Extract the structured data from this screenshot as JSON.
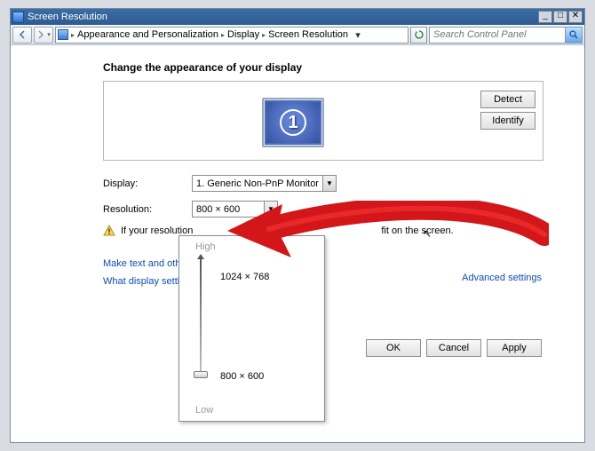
{
  "window": {
    "title": "Screen Resolution"
  },
  "winbtns": {
    "min": "_",
    "max": "□",
    "close": "✕"
  },
  "breadcrumbs": {
    "item1": "Appearance and Personalization",
    "item2": "Display",
    "item3": "Screen Resolution",
    "sep": "▸"
  },
  "search": {
    "placeholder": "Search Control Panel"
  },
  "heading": "Change the appearance of your display",
  "monitor": {
    "number": "1"
  },
  "buttons": {
    "detect": "Detect",
    "identify": "Identify",
    "ok": "OK",
    "cancel": "Cancel",
    "apply": "Apply"
  },
  "form": {
    "display_label": "Display:",
    "display_value": "1. Generic Non-PnP Monitor",
    "resolution_label": "Resolution:",
    "resolution_value": "800 × 600"
  },
  "warning": {
    "prefix": "If your resolution",
    "suffix": "fit on the screen."
  },
  "links": {
    "advanced": "Advanced settings",
    "make_text": "Make text and other i",
    "what_display": "What display settings"
  },
  "dropdown": {
    "high_label": "High",
    "low_label": "Low",
    "option_high": "1024 × 768",
    "option_low": "800 × 600"
  }
}
